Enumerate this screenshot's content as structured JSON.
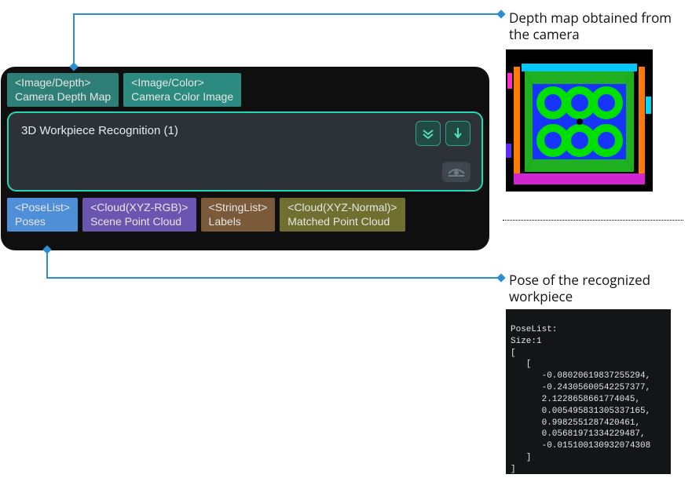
{
  "callouts": {
    "depth_title": "Depth map obtained from the camera",
    "pose_title": "Pose of the recognized workpiece"
  },
  "node": {
    "inputs": [
      {
        "type": "<Image/Depth>",
        "label": "Camera Depth Map"
      },
      {
        "type": "<Image/Color>",
        "label": "Camera Color Image"
      }
    ],
    "title": "3D Workpiece Recognition (1)",
    "outputs": [
      {
        "type": "<PoseList>",
        "label": "Poses"
      },
      {
        "type": "<Cloud(XYZ-RGB)>",
        "label": "Scene Point Cloud"
      },
      {
        "type": "<StringList>",
        "label": "Labels"
      },
      {
        "type": "<Cloud(XYZ-Normal)>",
        "label": "Matched Point Cloud"
      }
    ]
  },
  "poselist": {
    "header": "PoseList:",
    "size_label": "Size:1",
    "values": [
      -0.08020619837255294,
      -0.24305600542257377,
      2.1228658661774045,
      0.005495831305337165,
      0.9982551287420461,
      0.05681971334229487,
      -0.015100130932074308
    ]
  }
}
